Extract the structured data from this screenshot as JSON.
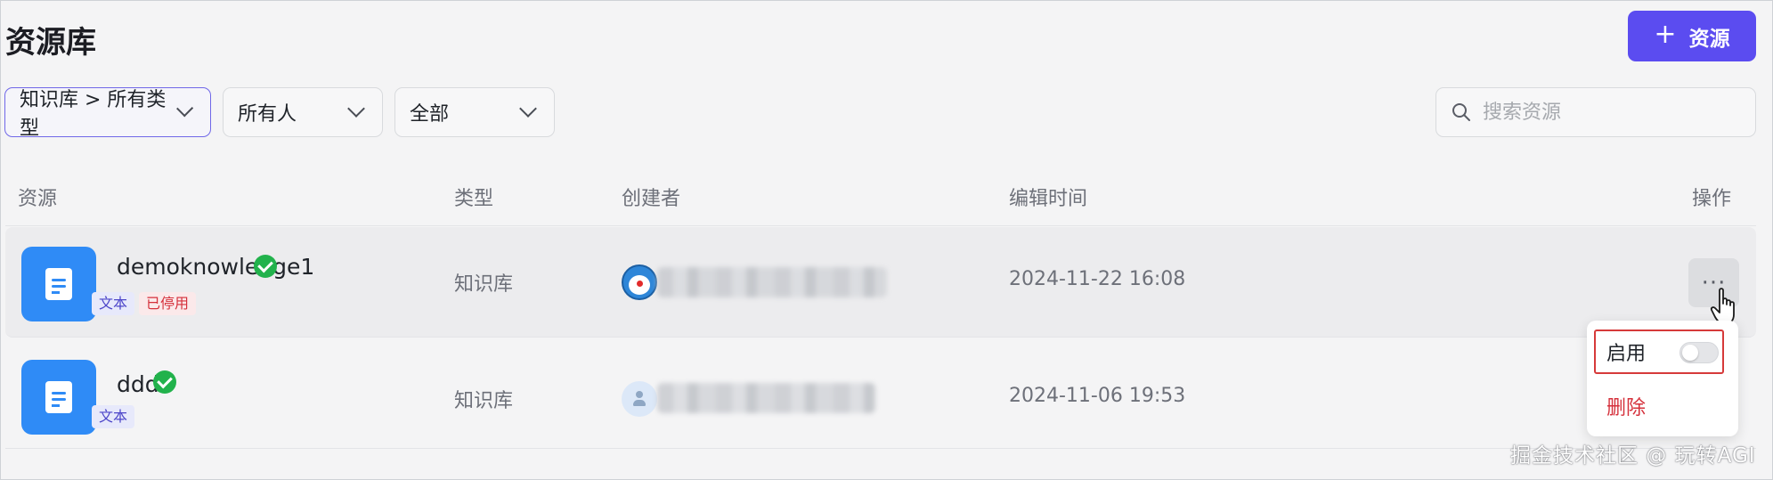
{
  "page": {
    "title": "资源库"
  },
  "toolbar": {
    "add_plus": "+",
    "add_label": "资源"
  },
  "filters": {
    "category": "知识库 > 所有类型",
    "owner": "所有人",
    "status": "全部"
  },
  "search": {
    "placeholder": "搜索资源"
  },
  "table": {
    "headers": {
      "resource": "资源",
      "type": "类型",
      "creator": "创建者",
      "edited": "编辑时间",
      "actions": "操作"
    },
    "rows": [
      {
        "name": "demoknowledge1",
        "tags": [
          "文本",
          "已停用"
        ],
        "type": "知识库",
        "edited": "2024-11-22 16:08",
        "verified": true
      },
      {
        "name": "ddd",
        "tags": [
          "文本"
        ],
        "type": "知识库",
        "edited": "2024-11-06 19:53",
        "verified": true
      }
    ]
  },
  "row_menu": {
    "more": "···",
    "enable": "启用",
    "enable_on": false,
    "delete": "删除"
  },
  "colors": {
    "accent": "#5b4cf0",
    "success": "#22b24c",
    "danger": "#d5303b",
    "icon_blue": "#2f8bf6"
  },
  "watermark": "掘金技术社区 @ 玩转AGI"
}
